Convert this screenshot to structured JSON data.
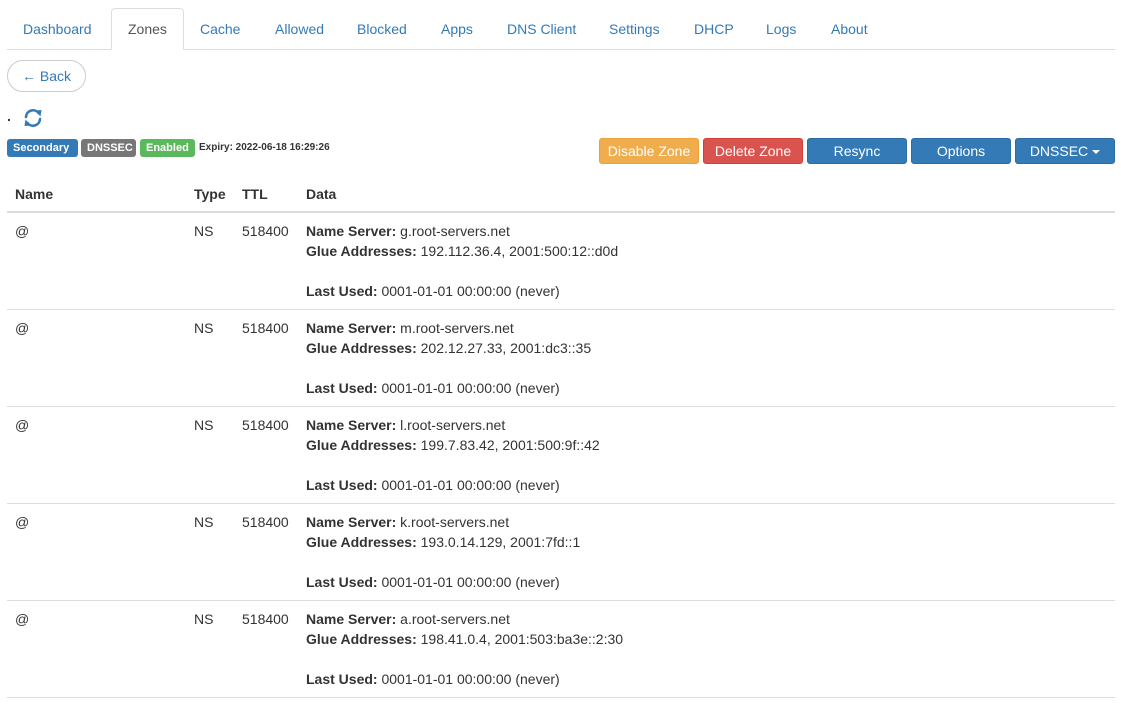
{
  "tabs": [
    "Dashboard",
    "Zones",
    "Cache",
    "Allowed",
    "Blocked",
    "Apps",
    "DNS Client",
    "Settings",
    "DHCP",
    "Logs",
    "About"
  ],
  "active_tab": "Zones",
  "back_label": "← Back",
  "zone": {
    "name": ".",
    "badges": {
      "type": "Secondary",
      "dnssec": "DNSSEC",
      "status": "Enabled"
    },
    "expiry": "Expiry: 2022-06-18 16:29:26"
  },
  "actions": {
    "disable": "Disable Zone",
    "delete": "Delete Zone",
    "resync": "Resync",
    "options": "Options",
    "dnssec": "DNSSEC"
  },
  "table": {
    "headers": {
      "name": "Name",
      "type": "Type",
      "ttl": "TTL",
      "data": "Data"
    },
    "labels": {
      "name_server": "Name Server:",
      "glue": "Glue Addresses:",
      "last_used": "Last Used:"
    },
    "rows": [
      {
        "name": "@",
        "type": "NS",
        "ttl": "518400",
        "name_server": "g.root-servers.net",
        "glue": "192.112.36.4, 2001:500:12::d0d",
        "last_used": "0001-01-01 00:00:00 (never)"
      },
      {
        "name": "@",
        "type": "NS",
        "ttl": "518400",
        "name_server": "m.root-servers.net",
        "glue": "202.12.27.33, 2001:dc3::35",
        "last_used": "0001-01-01 00:00:00 (never)"
      },
      {
        "name": "@",
        "type": "NS",
        "ttl": "518400",
        "name_server": "l.root-servers.net",
        "glue": "199.7.83.42, 2001:500:9f::42",
        "last_used": "0001-01-01 00:00:00 (never)"
      },
      {
        "name": "@",
        "type": "NS",
        "ttl": "518400",
        "name_server": "k.root-servers.net",
        "glue": "193.0.14.129, 2001:7fd::1",
        "last_used": "0001-01-01 00:00:00 (never)"
      },
      {
        "name": "@",
        "type": "NS",
        "ttl": "518400",
        "name_server": "a.root-servers.net",
        "glue": "198.41.0.4, 2001:503:ba3e::2:30",
        "last_used": "0001-01-01 00:00:00 (never)"
      }
    ]
  },
  "colors": {
    "link": "#337ab7",
    "warning": "#f0ad4e",
    "danger": "#d9534f",
    "primary": "#337ab7",
    "success": "#5cb85c",
    "default": "#777777"
  },
  "icons": {
    "refresh": "refresh-icon",
    "caret": "caret-down-icon"
  }
}
